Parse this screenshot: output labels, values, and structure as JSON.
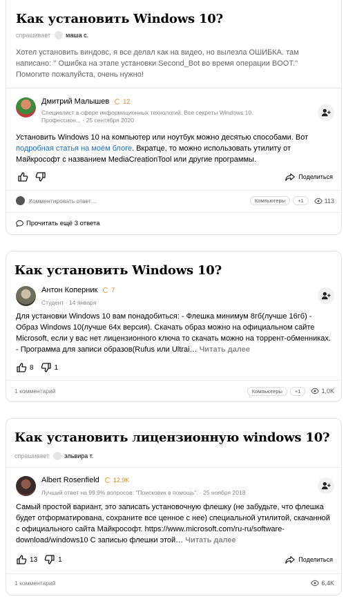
{
  "cards": [
    {
      "title": "Как установить Windows 10?",
      "asker_label": "спрашивает",
      "asker_name": "маша с.",
      "question_text": "Хотел установить виндовс, я все делал как на видео, но вылезла ОШИБКА. там написано: '' Ошибка на этапе установки Second_Bot во время операции BOOT.'' Помогите пожалуйста, очень нужно!",
      "author": {
        "name": "Дмитрий Малышев",
        "rating": "12",
        "subtitle_line1": "Специалист в сфере информационных технологий. Все секреты Windows 10.",
        "subtitle_line2": "Профессион... · 25 сентября 2020"
      },
      "answer_prefix": "Установить Windows 10 на компьютер или ноутбук можно десятью способами. Вот ",
      "answer_link": "подробная статья на моём блоге",
      "answer_suffix": ". Вкратце, то можно использовать утилиту от Майкрософт с названием MediaCreationTool или другие программы.",
      "share_label": "Поделиться",
      "comment_placeholder": "Комментировать ответ…",
      "tag": "Компьютеры",
      "plus_tag": "+1",
      "views": "113",
      "more_answers": "Прочитать ещё 3 ответа"
    },
    {
      "title": "Как установить Windows 10?",
      "author": {
        "name": "Антон Коперник",
        "rating": "7",
        "subtitle": "Студент · 14 января"
      },
      "answer_text": "Для установки Windows 10 вам понадобиться: - Флешка минимум 8гб(лучше 16гб) - Образ Windows 10(лучше 64х версия). Скачать образ можно на официальном сайте Microsoft, если у вас нет лицензионного ключа то скачать можно на торрент-обменниках. - Программа для записи образов(Rufus или Ultrai… ",
      "read_more": "Читать далее",
      "likes": "8",
      "dislikes": "1",
      "comments": "1 комментарий",
      "tag": "Компьютеры",
      "plus_tag": "+1",
      "views": "1,0K"
    },
    {
      "title": "Как установить лицензионную windows 10?",
      "asker_label": "спрашивает",
      "asker_name": "эльвира т.",
      "author": {
        "name": "Albert Rosenfield",
        "rating": "12,9K",
        "subtitle": "Лучший ответ на 99.9% вопросов: \"Поисковик в помощь\". · 25 ноября 2018"
      },
      "answer_text": "Самый простой вариант, это записать установочную флешку (не забудьте, что флешка будет отформатирована, сохраните все ценное с нее) специальной утилитой, скачанной с официального сайта Майкрософт. https://www.microsoft.com/ru-ru/software-download/windows10 С записью флешки этой… ",
      "read_more": "Читать далее",
      "likes": "13",
      "dislikes": "1",
      "share_label": "Поделиться",
      "comments": "1 комментарий",
      "views": "6,4K"
    }
  ]
}
